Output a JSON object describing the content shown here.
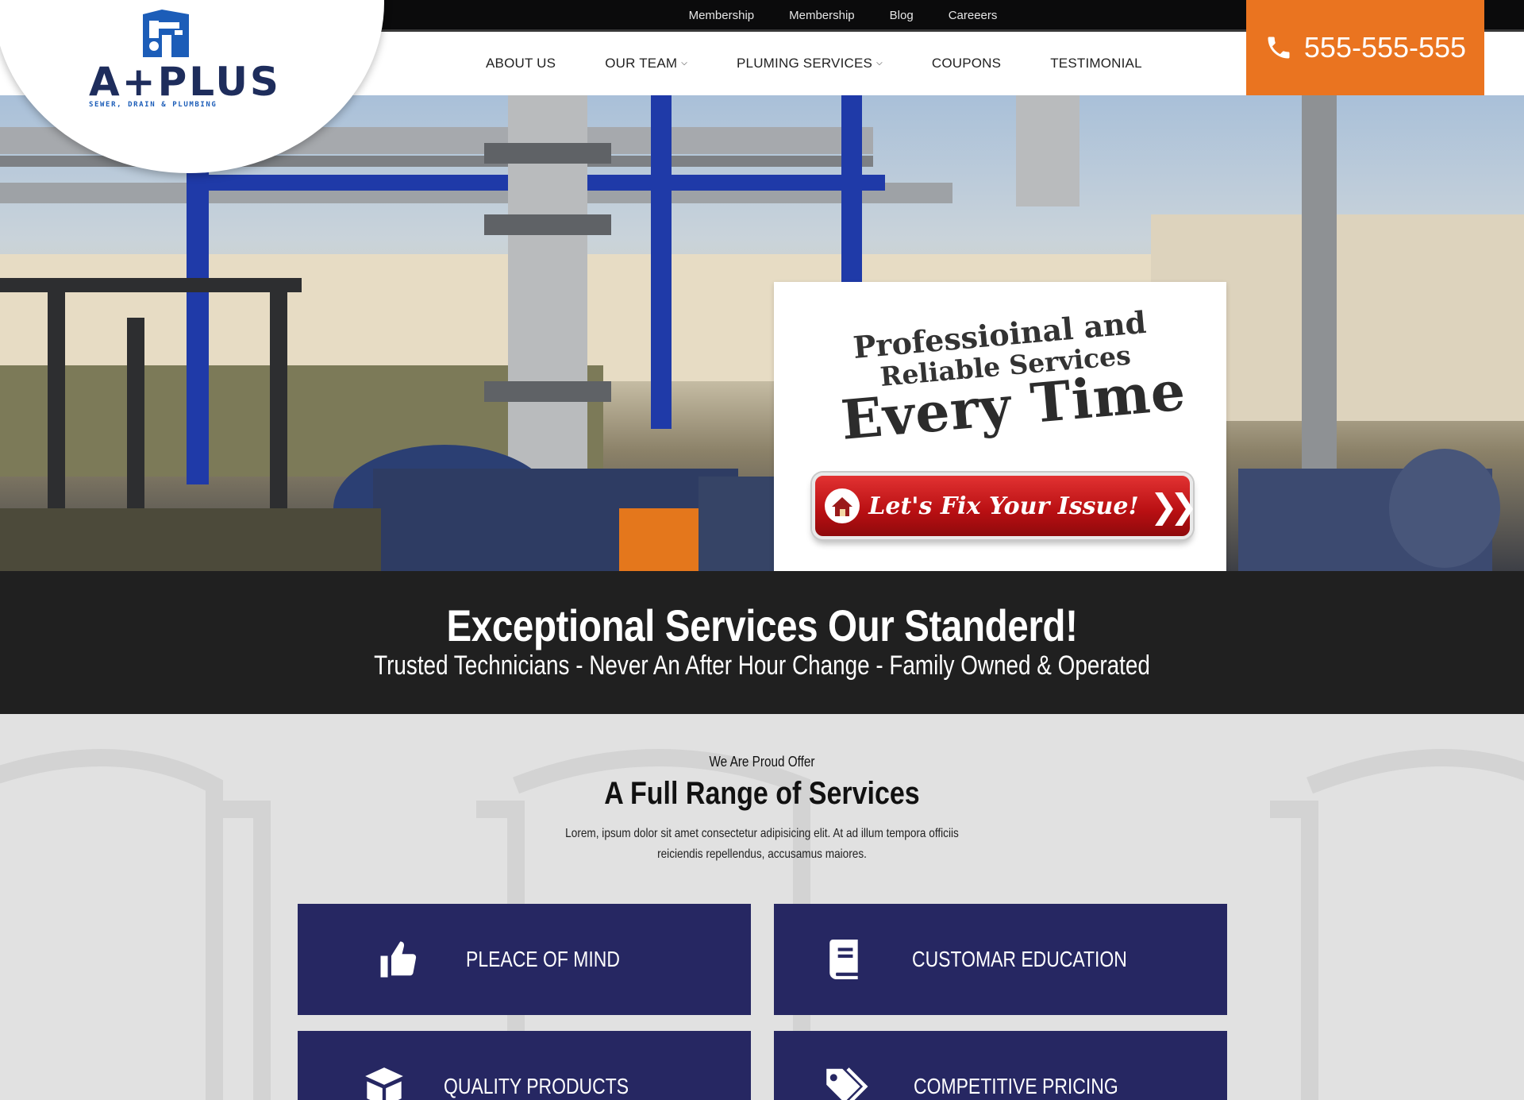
{
  "topbar": {
    "links": [
      "Membership",
      "Membership",
      "Blog",
      "Careeers"
    ]
  },
  "logo": {
    "word": "A+PLUS",
    "tagline": "SEWER, DRAIN & PLUMBING"
  },
  "nav": {
    "items": [
      {
        "label": "ABOUT US",
        "dropdown": false
      },
      {
        "label": "OUR TEAM",
        "dropdown": true
      },
      {
        "label": "PLUMING SERVICES",
        "dropdown": true
      },
      {
        "label": "COUPONS",
        "dropdown": false
      },
      {
        "label": "TESTIMONIAL",
        "dropdown": false
      }
    ]
  },
  "phone": {
    "number": "555-555-555",
    "icon": "phone-icon"
  },
  "hero": {
    "line1": "Professioinal and",
    "line2": "Reliable Services",
    "line3": "Every Time",
    "cta_label": "Let's Fix Your Issue!",
    "cta_icon": "house-icon"
  },
  "band": {
    "title": "Exceptional Services Our Standerd!",
    "subtitle": "Trusted Technicians - Never An After Hour Change - Family Owned & Operated"
  },
  "services": {
    "kicker": "We Are Proud Offer",
    "title": "A Full Range of Services",
    "description": "Lorem, ipsum dolor sit amet consectetur adipisicing elit. At ad illum tempora officiis reiciendis repellendus, accusamus maiores.",
    "tiles": [
      {
        "label": "PLEACE OF MIND",
        "icon": "thumbs-up-icon"
      },
      {
        "label": "CUSTOMAR EDUCATION",
        "icon": "book-icon"
      },
      {
        "label": "QUALITY PRODUCTS",
        "icon": "box-icon"
      },
      {
        "label": "COMPETITIVE PRICING",
        "icon": "tags-icon"
      }
    ]
  },
  "colors": {
    "accent_orange": "#ea7420",
    "tile_navy": "#262762",
    "band_dark": "#202020",
    "cta_red": "#c0161a",
    "logo_navy": "#1e2d5c",
    "logo_blue": "#1c5db8"
  }
}
